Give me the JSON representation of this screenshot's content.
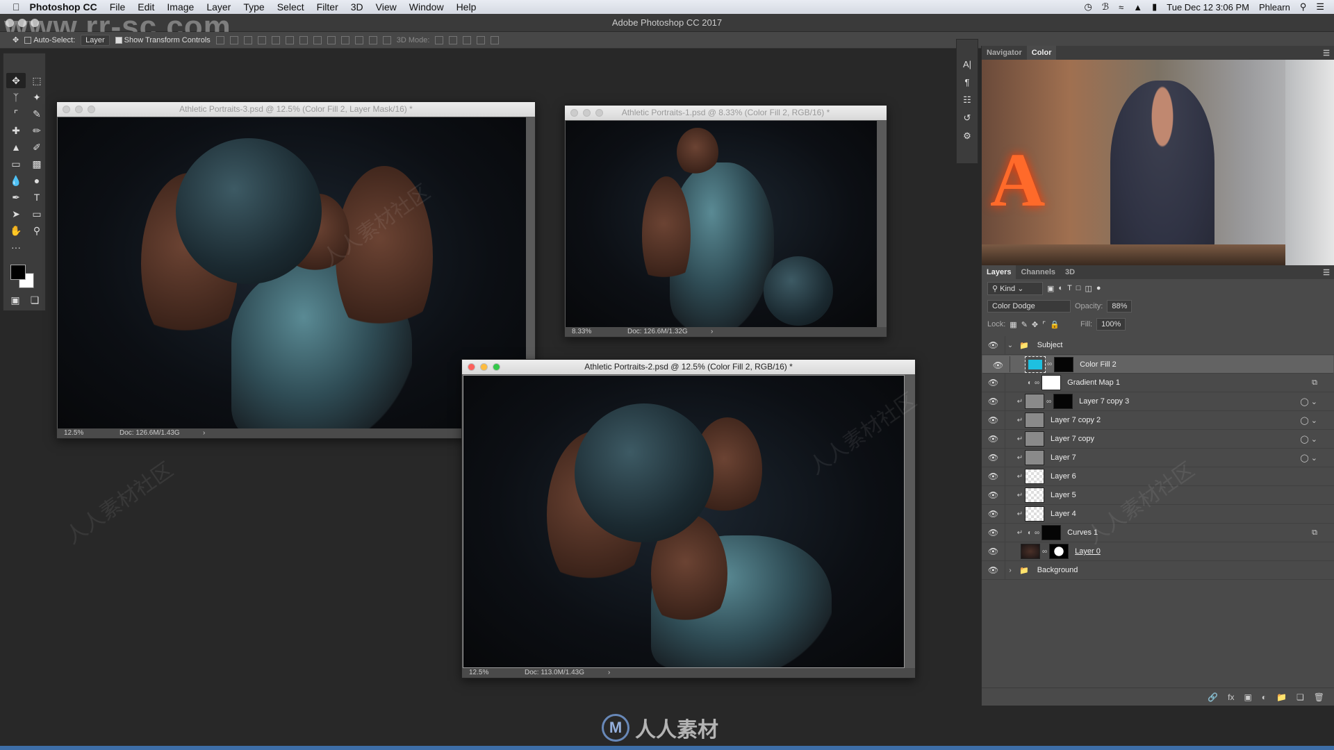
{
  "menubar": {
    "app": "Photoshop CC",
    "items": [
      "File",
      "Edit",
      "Image",
      "Layer",
      "Type",
      "Select",
      "Filter",
      "3D",
      "View",
      "Window",
      "Help"
    ],
    "datetime": "Tue Dec 12  3:06 PM",
    "user": "Phlearn"
  },
  "title": "Adobe Photoshop CC 2017",
  "options": {
    "auto_select_label": "Auto-Select:",
    "auto_select_value": "Layer",
    "show_transform_label": "Show Transform Controls",
    "mode_3d_label": "3D Mode:"
  },
  "documents": [
    {
      "title": "Athletic Portraits-3.psd @ 12.5% (Color Fill 2, Layer Mask/16) *",
      "zoom": "12.5%",
      "doc": "Doc: 126.6M/1.43G"
    },
    {
      "title": "Athletic Portraits-1.psd @ 8.33% (Color Fill 2, RGB/16) *",
      "zoom": "8.33%",
      "doc": "Doc: 126.6M/1.32G"
    },
    {
      "title": "Athletic Portraits-2.psd @ 12.5% (Color Fill 2, RGB/16) *",
      "zoom": "12.5%",
      "doc": "Doc: 113.0M/1.43G"
    }
  ],
  "top_panel": {
    "tabs": [
      "Navigator",
      "Color"
    ],
    "active": "Color"
  },
  "layers_panel": {
    "tabs": [
      "Layers",
      "Channels",
      "3D"
    ],
    "filter": "Kind",
    "blend_mode": "Color Dodge",
    "opacity_label": "Opacity:",
    "opacity": "88%",
    "lock_label": "Lock:",
    "fill_label": "Fill:",
    "fill": "100%",
    "layers": [
      {
        "name": "Subject",
        "type": "group",
        "expanded": true
      },
      {
        "name": "Color Fill 2",
        "type": "fill",
        "selected": true,
        "fill_color": "#1ec0e0"
      },
      {
        "name": "Gradient Map 1",
        "type": "adjustment"
      },
      {
        "name": "Layer 7 copy 3",
        "type": "smart",
        "clipped": true,
        "mask": true
      },
      {
        "name": "Layer 7 copy 2",
        "type": "smart",
        "clipped": true
      },
      {
        "name": "Layer 7 copy",
        "type": "smart",
        "clipped": true
      },
      {
        "name": "Layer 7",
        "type": "smart",
        "clipped": true
      },
      {
        "name": "Layer 6",
        "type": "pixel",
        "clipped": true
      },
      {
        "name": "Layer 5",
        "type": "pixel",
        "clipped": true
      },
      {
        "name": "Layer 4",
        "type": "pixel",
        "clipped": true
      },
      {
        "name": "Curves 1",
        "type": "adjustment",
        "clipped": true
      },
      {
        "name": "Layer 0",
        "type": "photo",
        "mask": true
      },
      {
        "name": "Background",
        "type": "group",
        "expanded": false
      }
    ]
  },
  "watermark": {
    "site": "www.rr-sc.com",
    "logo_text": "人人素材",
    "pattern": "人人素材社区"
  },
  "colors": {
    "accent_fill": "#1ec0e0",
    "ui_bg": "#282828",
    "panel": "#4a4a4a"
  }
}
